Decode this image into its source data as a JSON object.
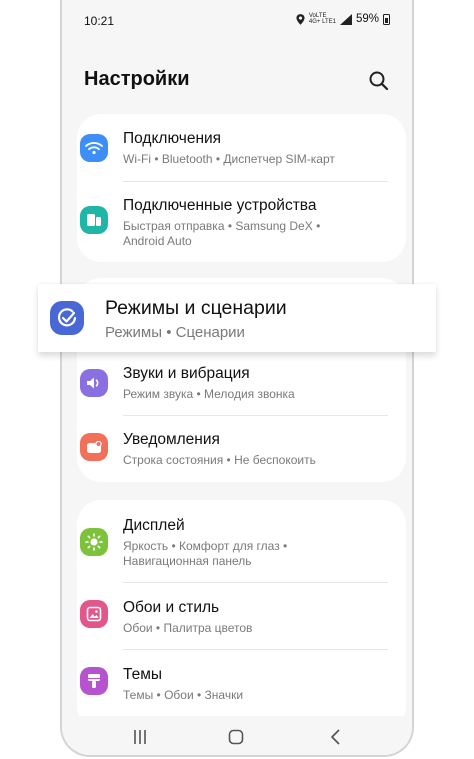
{
  "status_bar": {
    "time": "10:21",
    "signal_top": "VoLTE",
    "signal_bottom": "4G+ LTE1",
    "battery": "59%"
  },
  "header": {
    "title": "Настройки"
  },
  "groups": [
    {
      "items": [
        {
          "title": "Подключения",
          "sub1": "Wi-Fi  •  Bluetooth  •  Диспетчер SIM-карт",
          "sub2": "",
          "icon": "wifi-icon",
          "color": "#3d8ff5"
        },
        {
          "title": "Подключенные устройства",
          "sub1": "Быстрая отправка  •  Samsung DeX  •",
          "sub2": "Android Auto",
          "icon": "devices-icon",
          "color": "#1fb6a8"
        }
      ]
    },
    {
      "items": [
        {
          "title": "Звуки и вибрация",
          "sub1": "Режим звука  •  Мелодия звонка",
          "sub2": "",
          "icon": "speaker-icon",
          "color": "#8a6fe0"
        },
        {
          "title": "Уведомления",
          "sub1": "Строка состояния  •  Не беспокоить",
          "sub2": "",
          "icon": "notification-icon",
          "color": "#f2705a"
        }
      ]
    },
    {
      "items": [
        {
          "title": "Дисплей",
          "sub1": "Яркость  •  Комфорт для глаз  •",
          "sub2": "Навигационная панель",
          "icon": "brightness-icon",
          "color": "#7cc23a"
        },
        {
          "title": "Обои и стиль",
          "sub1": "Обои  •  Палитра цветов",
          "sub2": "",
          "icon": "wallpaper-icon",
          "color": "#e2568c"
        },
        {
          "title": "Темы",
          "sub1": "Темы  •  Обои  •  Значки",
          "sub2": "",
          "icon": "brush-icon",
          "color": "#b654cf"
        }
      ]
    }
  ],
  "highlight": {
    "title": "Режимы и сценарии",
    "sub": "Режимы  •  Сценарии",
    "icon": "modes-check-icon",
    "color": "#4a67d6"
  },
  "navbar": {
    "recent": "recent-apps-icon",
    "home": "home-icon",
    "back": "back-icon"
  }
}
